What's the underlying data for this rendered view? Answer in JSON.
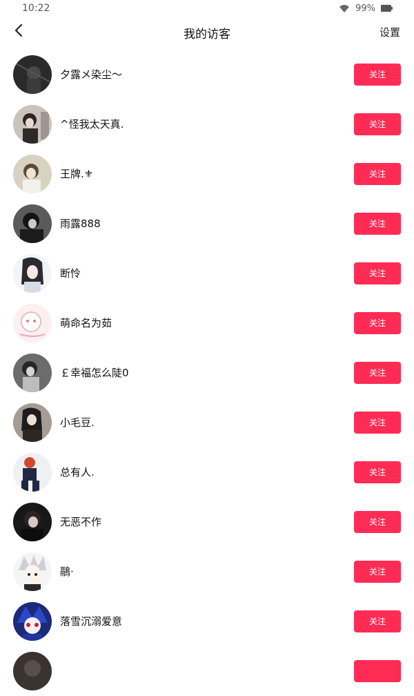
{
  "status_bar": {
    "time": "10:22",
    "battery_percent": "99%",
    "wifi_icon": "wifi-icon",
    "battery_icon": "battery-icon"
  },
  "header": {
    "back_icon": "chevron-left-icon",
    "title": "我的访客",
    "settings_label": "设置"
  },
  "colors": {
    "accent": "#fe2c55",
    "text": "#111111",
    "background": "#ffffff"
  },
  "visitors": [
    {
      "name": "夕露メ染尘～",
      "follow_label": "关注"
    },
    {
      "name": "^怪我太天真.",
      "follow_label": "关注"
    },
    {
      "name": "王牌.⚜",
      "follow_label": "关注"
    },
    {
      "name": "雨露888",
      "follow_label": "关注"
    },
    {
      "name": "断怜",
      "follow_label": "关注"
    },
    {
      "name": "萌命名为茹",
      "follow_label": "关注"
    },
    {
      "name": "￡幸福怎么陡0",
      "follow_label": "关注"
    },
    {
      "name": "小毛豆.",
      "follow_label": "关注"
    },
    {
      "name": "总有人.",
      "follow_label": "关注"
    },
    {
      "name": "无恶不作",
      "follow_label": "关注"
    },
    {
      "name": "鷊·",
      "follow_label": "关注"
    },
    {
      "name": "落雪沉溺爱意",
      "follow_label": "关注"
    },
    {
      "name": "",
      "follow_label": ""
    }
  ]
}
